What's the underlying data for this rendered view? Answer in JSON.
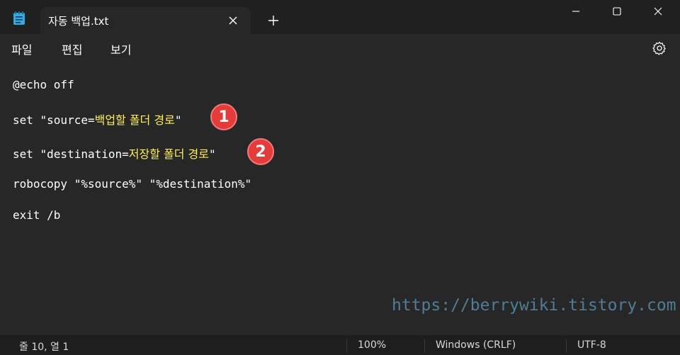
{
  "window": {
    "tab_title": "자동 백업.txt",
    "app_icon": "notepad-icon",
    "tab_close_icon": "close-icon",
    "new_tab_icon": "plus-icon",
    "minimize_icon": "minimize-icon",
    "maximize_icon": "maximize-icon",
    "close_icon": "close-icon"
  },
  "menu": {
    "items": [
      "파일",
      "편집",
      "보기"
    ],
    "settings_icon": "gear-icon"
  },
  "editor": {
    "lines": [
      {
        "code": "@echo off"
      },
      {
        "code": "set \"source=",
        "highlight": "백업할 폴더 경로",
        "tail": "\""
      },
      {
        "code": "set \"destination=",
        "highlight": "저장할 폴더 경로",
        "tail": "\""
      },
      {
        "code": "robocopy \"%source%\" \"%destination%\""
      },
      {
        "code": "exit /b"
      }
    ],
    "highlight_color": "#ffee55",
    "annotations": [
      "1",
      "2"
    ],
    "annotation_color": "#e43b3b",
    "watermark": "https://berrywiki.tistory.com"
  },
  "status": {
    "position": "줄 10, 열 1",
    "zoom": "100%",
    "line_ending": "Windows (CRLF)",
    "encoding": "UTF-8"
  }
}
